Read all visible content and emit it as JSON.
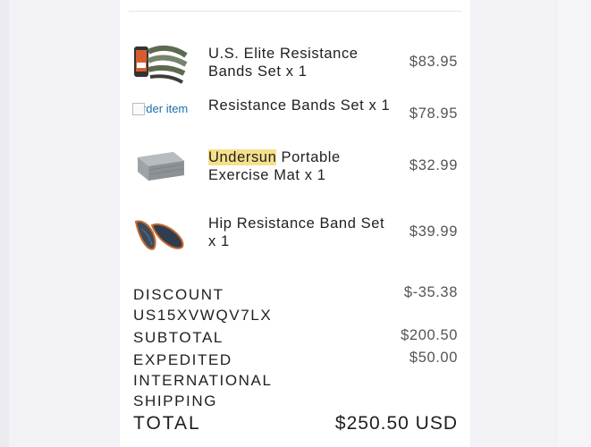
{
  "order": {
    "items": [
      {
        "name": "U.S. Elite Resistance Bands Set x 1",
        "price": "$83.95",
        "image": "resistance-bands-product-image"
      },
      {
        "name": "Resistance Bands Set x 1",
        "price": "$78.95",
        "image_alt": "order item"
      },
      {
        "name_highlight": "Undersun",
        "name_rest": " Portable Exercise Mat x 1",
        "price": "$32.99",
        "image": "exercise-mat-image"
      },
      {
        "name": "Hip Resistance Band Set x 1",
        "price": "$39.99",
        "image": "hip-bands-image"
      }
    ]
  },
  "summary": {
    "discount_label": "DISCOUNT US15XVWQV7LX",
    "discount_value": "$-35.38",
    "subtotal_label": "SUBTOTAL",
    "subtotal_value": "$200.50",
    "shipping_label": "EXPEDITED INTERNATIONAL SHIPPING",
    "shipping_value": "$50.00",
    "total_label": "TOTAL",
    "total_value": "$250.50 USD"
  },
  "colors": {
    "highlight": "#f7e08c",
    "page_bg": "#f2f2f7",
    "card_bg": "#ffffff"
  }
}
